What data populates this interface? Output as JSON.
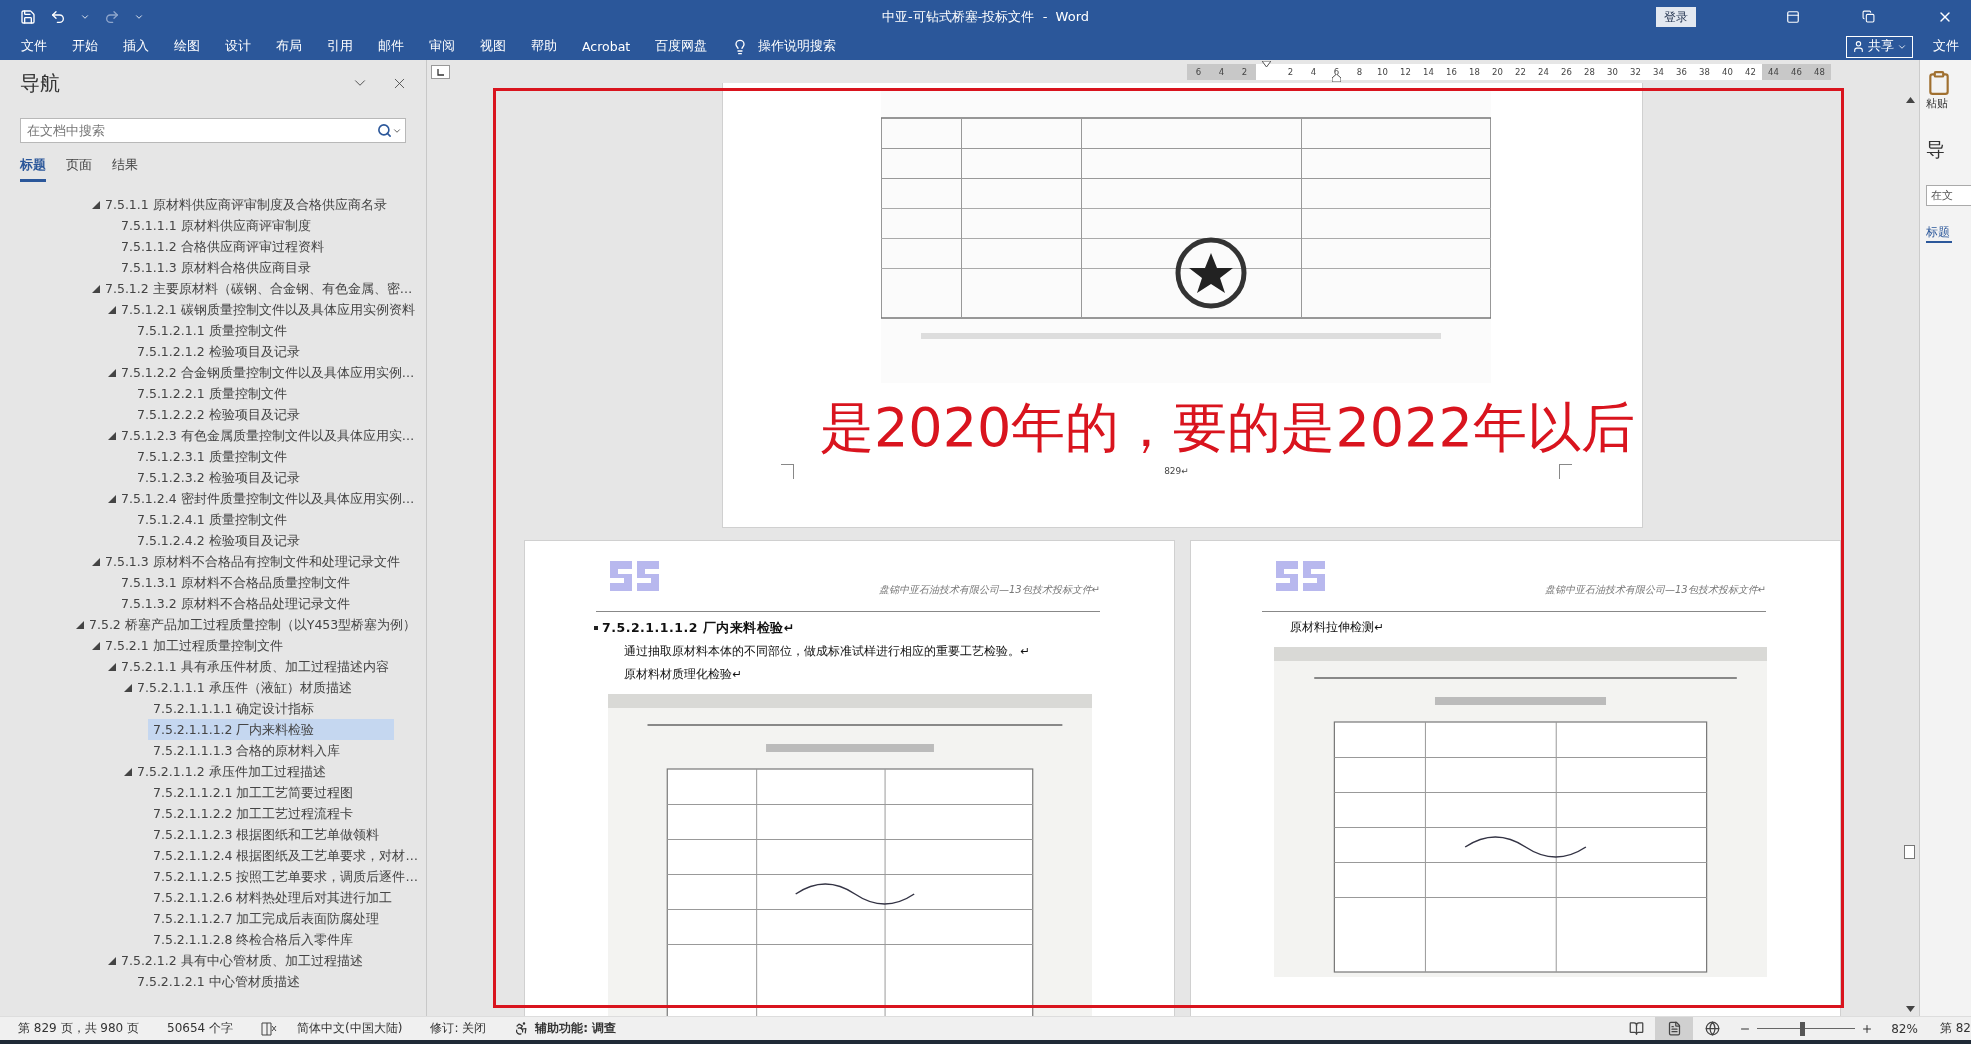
{
  "title_bar": {
    "title": "中亚-可钻式桥塞-投标文件  -  Word",
    "sign_in": "登录"
  },
  "menu": [
    "文件",
    "开始",
    "插入",
    "绘图",
    "设计",
    "布局",
    "引用",
    "邮件",
    "审阅",
    "视图",
    "帮助",
    "Acrobat",
    "百度网盘"
  ],
  "tell_me": "操作说明搜索",
  "share": "共享",
  "right_menu": "文件",
  "ruler": {
    "left_ticks": [
      "6",
      "4",
      "2"
    ],
    "ticks": [
      "2",
      "4",
      "6",
      "8",
      "10",
      "12",
      "14",
      "16",
      "18",
      "20",
      "22",
      "24",
      "26",
      "28",
      "30",
      "32",
      "34",
      "36",
      "38",
      "40",
      "42"
    ],
    "right_ticks": [
      "44",
      "46",
      "48"
    ]
  },
  "nav": {
    "title": "导航",
    "search": {
      "placeholder": "在文档中搜索"
    },
    "tabs": [
      {
        "label": "标题",
        "selected": true
      },
      {
        "label": "页面",
        "selected": false
      },
      {
        "label": "结果",
        "selected": false
      }
    ],
    "outline": [
      {
        "children": [
          {
            "label": "7.5.1.1 原材料供应商评审制度及合格供应商名录",
            "expanded": true,
            "selected": false,
            "children": [
              {
                "label": "7.5.1.1.1 原材料供应商评审制度",
                "selected": false
              },
              {
                "label": "7.5.1.1.2 合格供应商评审过程资料",
                "selected": false
              },
              {
                "label": "7.5.1.1.3 原材料合格供应商目录",
                "selected": false
              }
            ]
          },
          {
            "label": "7.5.1.2 主要原材料（碳钢、合金钢、有色金属、密…",
            "expanded": true,
            "selected": false,
            "children": [
              {
                "label": "7.5.1.2.1 碳钢质量控制文件以及具体应用实例资料",
                "expanded": true,
                "selected": false,
                "children": [
                  {
                    "label": "7.5.1.2.1.1 质量控制文件",
                    "selected": false
                  },
                  {
                    "label": "7.5.1.2.1.2 检验项目及记录",
                    "selected": false
                  }
                ]
              },
              {
                "label": "7.5.1.2.2 合金钢质量控制文件以及具体应用实例…",
                "expanded": true,
                "selected": false,
                "children": [
                  {
                    "label": "7.5.1.2.2.1 质量控制文件",
                    "selected": false
                  },
                  {
                    "label": "7.5.1.2.2.2 检验项目及记录",
                    "selected": false
                  }
                ]
              },
              {
                "label": "7.5.1.2.3 有色金属质量控制文件以及具体应用实…",
                "expanded": true,
                "selected": false,
                "children": [
                  {
                    "label": "7.5.1.2.3.1 质量控制文件",
                    "selected": false
                  },
                  {
                    "label": "7.5.1.2.3.2 检验项目及记录",
                    "selected": false
                  }
                ]
              },
              {
                "label": "7.5.1.2.4 密封件质量控制文件以及具体应用实例…",
                "expanded": true,
                "selected": false,
                "children": [
                  {
                    "label": "7.5.1.2.4.1 质量控制文件",
                    "selected": false
                  },
                  {
                    "label": "7.5.1.2.4.2 检验项目及记录",
                    "selected": false
                  }
                ]
              }
            ]
          },
          {
            "label": "7.5.1.3 原材料不合格品有控制文件和处理记录文件",
            "expanded": true,
            "selected": false,
            "children": [
              {
                "label": "7.5.1.3.1 原材料不合格品质量控制文件",
                "selected": false
              },
              {
                "label": "7.5.1.3.2 原材料不合格品处理记录文件",
                "selected": false
              }
            ]
          }
        ]
      },
      {
        "label": "7.5.2 桥塞产品加工过程质量控制（以Y453型桥塞为例）",
        "expanded": true,
        "selected": false,
        "children": [
          {
            "label": "7.5.2.1 加工过程质量控制文件",
            "expanded": true,
            "selected": false,
            "children": [
              {
                "label": "7.5.2.1.1 具有承压件材质、加工过程描述内容",
                "expanded": true,
                "selected": false,
                "children": [
                  {
                    "label": "7.5.2.1.1.1 承压件（液缸）材质描述",
                    "expanded": true,
                    "selected": false,
                    "children": [
                      {
                        "label": "7.5.2.1.1.1.1 确定设计指标",
                        "selected": false
                      },
                      {
                        "label": "7.5.2.1.1.1.2 厂内来料检验",
                        "selected": true
                      },
                      {
                        "label": "7.5.2.1.1.1.3 合格的原材料入库",
                        "selected": false
                      }
                    ]
                  },
                  {
                    "label": "7.5.2.1.1.2 承压件加工过程描述",
                    "expanded": true,
                    "selected": false,
                    "children": [
                      {
                        "label": "7.5.2.1.1.2.1 加工工艺简要过程图",
                        "selected": false
                      },
                      {
                        "label": "7.5.2.1.1.2.2 加工工艺过程流程卡",
                        "selected": false
                      },
                      {
                        "label": "7.5.2.1.1.2.3 根据图纸和工艺单做领料",
                        "selected": false
                      },
                      {
                        "label": "7.5.2.1.1.2.4 根据图纸及工艺单要求，对材…",
                        "selected": false
                      },
                      {
                        "label": "7.5.2.1.1.2.5 按照工艺单要求，调质后逐件…",
                        "selected": false
                      },
                      {
                        "label": "7.5.2.1.1.2.6 材料热处理后对其进行加工",
                        "selected": false
                      },
                      {
                        "label": "7.5.2.1.1.2.7 加工完成后表面防腐处理",
                        "selected": false
                      },
                      {
                        "label": "7.5.2.1.1.2.8 终检合格后入零件库",
                        "selected": false
                      }
                    ]
                  }
                ]
              },
              {
                "label": "7.5.2.1.2 具有中心管材质、加工过程描述",
                "expanded": true,
                "selected": false,
                "children": [
                  {
                    "label": "7.5.2.1.2.1 中心管材质描述",
                    "selected": false
                  }
                ]
              }
            ]
          }
        ]
      }
    ]
  },
  "document": {
    "top_page": {
      "annotation": "是2020年的，要的是2022年以后",
      "page_number": "829↵"
    },
    "pages": [
      {
        "header": "盘锦中亚石油技术有限公司—13包技术投标文件↵",
        "blocks": [
          {
            "kind": "heading",
            "text": "7.5.2.1.1.1.2 厂内来料检验↵"
          },
          {
            "kind": "paragraph",
            "text": "通过抽取原材料本体的不同部位，做成标准试样进行相应的重要工艺检验。↵"
          },
          {
            "kind": "paragraph",
            "text": "原材料材质理化检验↵"
          }
        ]
      },
      {
        "header": "盘锦中亚石油技术有限公司—13包技术投标文件↵",
        "blocks": [
          {
            "kind": "paragraph",
            "text": "原材料拉伸检测↵"
          }
        ]
      }
    ]
  },
  "right_pane": {
    "paste": "粘贴",
    "nav_title": "导",
    "search": "在文",
    "tab": "标题"
  },
  "status_bar": {
    "page_info": "第 829 页，共 980 页",
    "word_count": "50654 个字",
    "language": "简体中文(中国大陆)",
    "track_changes": "修订: 关闭",
    "accessibility": "辅助功能: 调查",
    "views": [
      {
        "kind": "read",
        "selected": false
      },
      {
        "kind": "print",
        "selected": true
      },
      {
        "kind": "web",
        "selected": false
      }
    ],
    "zoom": {
      "level": 0.46,
      "percent": "82%"
    },
    "cut_text": "第 82"
  }
}
